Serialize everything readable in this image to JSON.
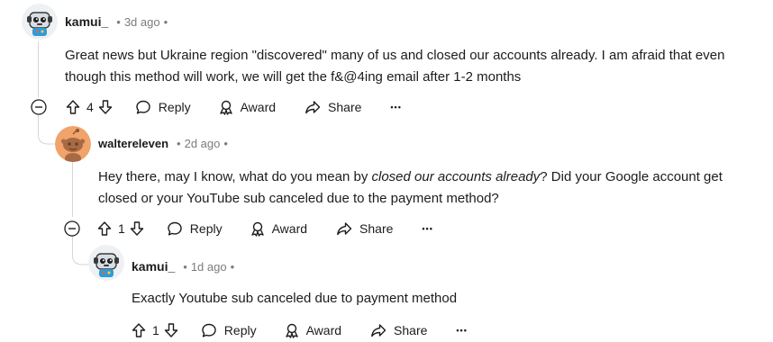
{
  "comments": [
    {
      "author": "kamui_",
      "separator": "•",
      "age": "3d ago",
      "trailing_dot": "•",
      "body_line1": "Great news but Ukraine region \"discovered\" many of us and closed our accounts already. I am afraid that even",
      "body_line2": "though this method will work, we will get the f&@4ing email after 1-2 months",
      "votes": "4",
      "reply_label": "Reply",
      "award_label": "Award",
      "share_label": "Share",
      "more_label": "•••"
    },
    {
      "author": "waltereleven",
      "separator": "•",
      "age": "2d ago",
      "trailing_dot": "•",
      "body_pre": "Hey there, may I know, what do you mean by ",
      "body_em": "closed our accounts already",
      "body_post": "? Did your Google account get",
      "body_line2": "closed or your YouTube sub canceled due to the payment method?",
      "votes": "1",
      "reply_label": "Reply",
      "award_label": "Award",
      "share_label": "Share",
      "more_label": "•••"
    },
    {
      "author": "kamui_",
      "separator": "•",
      "age": "1d ago",
      "trailing_dot": "•",
      "body_line1": "Exactly Youtube sub canceled due to payment method",
      "votes": "1",
      "reply_label": "Reply",
      "award_label": "Award",
      "share_label": "Share",
      "more_label": "•••"
    }
  ],
  "colors": {
    "text": "#1c1c1c",
    "meta": "#7c7c7c",
    "thread_line": "#d6d6d6",
    "avatar_orange": "#f0a36a"
  },
  "icons": [
    "robot-avatar-icon",
    "snoo-avatar-icon",
    "collapse-minus-icon",
    "upvote-icon",
    "downvote-icon",
    "reply-bubble-icon",
    "award-icon",
    "share-icon",
    "more-icon"
  ]
}
